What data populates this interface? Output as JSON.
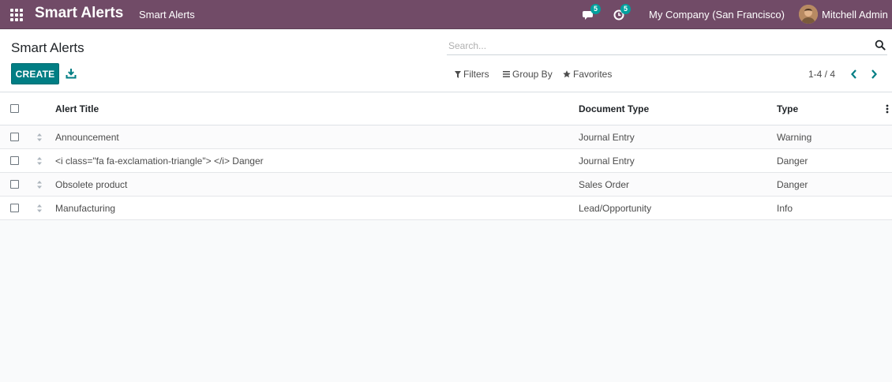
{
  "navbar": {
    "app_title": "Smart Alerts",
    "menu_item": "Smart Alerts",
    "messages_count": "5",
    "activities_count": "5",
    "company": "My Company (San Francisco)",
    "user": "Mitchell Admin",
    "color": "#714b67"
  },
  "control": {
    "breadcrumb": "Smart Alerts",
    "search_placeholder": "Search...",
    "create_label": "CREATE",
    "filters_label": "Filters",
    "groupby_label": "Group By",
    "favorites_label": "Favorites",
    "pager": "1-4 / 4",
    "accent": "#017e84"
  },
  "table": {
    "columns": [
      "Alert Title",
      "Document Type",
      "Type"
    ],
    "rows": [
      {
        "title": "Announcement",
        "doc_type": "Journal Entry",
        "type": "Warning"
      },
      {
        "title": "<i class=\"fa fa-exclamation-triangle\"> </i> Danger",
        "doc_type": "Journal Entry",
        "type": "Danger"
      },
      {
        "title": "Obsolete product",
        "doc_type": "Sales Order",
        "type": "Danger"
      },
      {
        "title": "Manufacturing",
        "doc_type": "Lead/Opportunity",
        "type": "Info"
      }
    ]
  },
  "icons": [
    "apps-icon",
    "chat-icon",
    "activity-clock-icon",
    "search-icon",
    "download-icon",
    "filter-icon",
    "group-by-icon",
    "star-icon",
    "chevron-left-icon",
    "chevron-right-icon",
    "drag-handle-icon",
    "optional-columns-icon"
  ]
}
